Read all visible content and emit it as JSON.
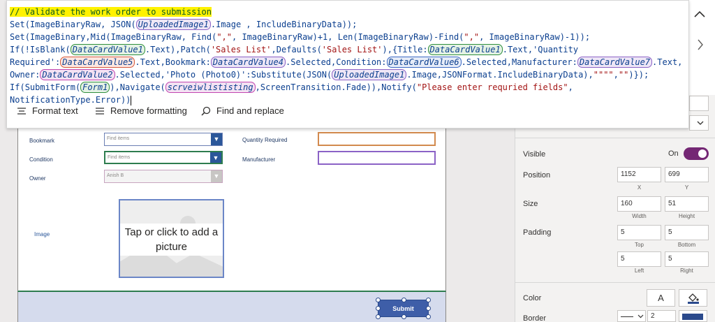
{
  "formula": {
    "comment": "// Validate the work order to submission",
    "code": {
      "set": "Set",
      "if": "If",
      "isblank": "IsBlank",
      "patch": "Patch",
      "defaults": "Defaults",
      "json": "JSON",
      "mid": "Mid",
      "find": "Find",
      "len": "Len",
      "substitute": "Substitute",
      "submitform": "SubmitForm",
      "navigate": "Navigate",
      "notify": "Notify",
      "imageBinaryRaw": "ImageBinaryRaw",
      "imageBinary": "ImageBinary",
      "uploadedImage1": "UploadedImage1",
      "includeBinaryData": "IncludeBinaryData",
      "dcv1": "DataCardValue1",
      "dcv2": "DataCardValue2",
      "dcv4": "DataCardValue4",
      "dcv5": "DataCardValue5",
      "dcv6": "DataCardValue6",
      "dcv7": "DataCardValue7",
      "form1": "Form1",
      "screen": "scrveiwlististing",
      "salesList": "'Sales List'",
      "quoteComma": "\",\"",
      "errMsg": "\"Please enter requried fields\"",
      "quadQuote": "\"\"\"\"",
      "emptyStr": "\"\"",
      "notificationType": "NotificationType",
      "error": "Error",
      "screenTransition": "ScreenTransition",
      "fade": "Fade",
      "jsonFormat": "JSONFormat",
      "imageProp": "Image",
      "textProp": "Text",
      "selectedProp": "Selected",
      "titleKey": "Title",
      "quantityKey": "'Quantity",
      "requiredKey": "Required'",
      "bookmarkKey": "Bookmark",
      "conditionKey": "Condition",
      "manufacturerKey": "Manufacturer",
      "ownerKey": "Owner",
      "photoKey": "'Photo (Photo0)'"
    },
    "toolbar": {
      "format_text": "Format text",
      "remove_formatting": "Remove formatting",
      "find_replace": "Find and replace"
    }
  },
  "form": {
    "labels": {
      "bookmark": "Bookmark",
      "condition": "Condition",
      "owner": "Owner",
      "quantity": "Quantity Required",
      "manufacturer": "Manufacturer",
      "image": "Image"
    },
    "dropdowns": {
      "bookmark_placeholder": "Find items",
      "condition_placeholder": "Find items",
      "owner_value": "Anish B"
    },
    "image_prompt": "Tap or click to add a picture",
    "submit_label": "Submit"
  },
  "panel": {
    "visible_label": "Visible",
    "visible_state": "On",
    "position_label": "Position",
    "x_value": "1152",
    "y_value": "699",
    "x_sub": "X",
    "y_sub": "Y",
    "size_label": "Size",
    "width_value": "160",
    "height_value": "51",
    "width_sub": "Width",
    "height_sub": "Height",
    "padding_label": "Padding",
    "pad_top": "5",
    "pad_bottom": "5",
    "pad_left": "5",
    "pad_right": "5",
    "top_sub": "Top",
    "bottom_sub": "Bottom",
    "left_sub": "Left",
    "right_sub": "Right",
    "color_label": "Color",
    "font_color_glyph": "A",
    "border_label": "Border",
    "border_width": "2"
  },
  "colors": {
    "accent": "#742774",
    "submit": "#3e5ea8",
    "form_border": "#2e7d4f",
    "comment_highlight": "#fff200"
  }
}
